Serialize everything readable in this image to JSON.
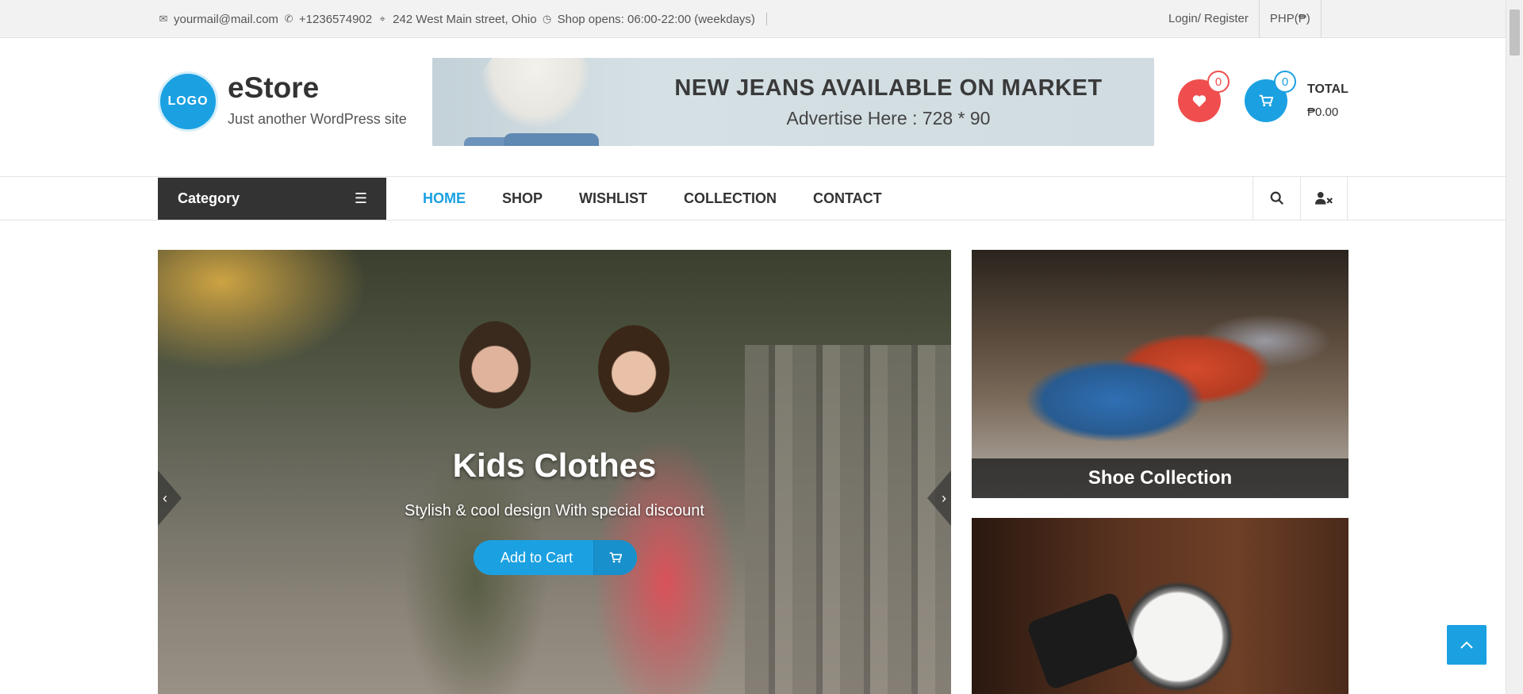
{
  "topbar": {
    "email": "yourmail@mail.com",
    "phone": "+1236574902",
    "address": "242 West Main street, Ohio",
    "hours": "Shop opens: 06:00-22:00 (weekdays)",
    "login": "Login/ Register",
    "currency": "PHP(₱)"
  },
  "header": {
    "logo": "LOGO",
    "site_title": "eStore",
    "site_desc": "Just another WordPress site",
    "ad_title": "NEW JEANS AVAILABLE ON MARKET",
    "ad_sub": "Advertise Here : 728 * 90",
    "wishlist_count": "0",
    "cart_count": "0",
    "total_label": "TOTAL",
    "total_value": "₱0.00"
  },
  "nav": {
    "category": "Category",
    "items": [
      "HOME",
      "SHOP",
      "WISHLIST",
      "COLLECTION",
      "CONTACT"
    ],
    "active": "HOME"
  },
  "slider": {
    "title": "Kids Clothes",
    "subtitle": "Stylish & cool design With special discount",
    "cta": "Add to Cart"
  },
  "cards": {
    "shoe_caption": "Shoe Collection"
  },
  "icons": {
    "email": "envelope-icon",
    "phone": "phone-icon",
    "address": "map-marker-icon",
    "hours": "clock-icon",
    "wishlist": "heart-icon",
    "cart": "shopping-cart-icon",
    "menu": "bars-icon",
    "search": "search-icon",
    "user": "user-times-icon",
    "prev": "chevron-left-icon",
    "next": "chevron-right-icon",
    "back_to_top": "chevron-up-icon"
  },
  "colors": {
    "accent": "#1ba1e2",
    "wishlist": "#f04e4e",
    "dark": "#333333"
  }
}
